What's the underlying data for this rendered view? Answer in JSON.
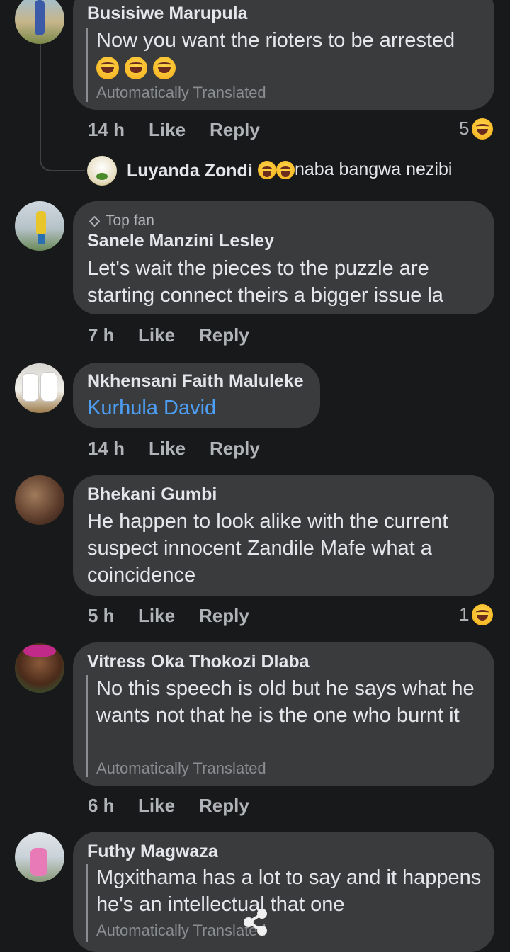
{
  "comments": [
    {
      "name": "Busisiwe Marupula",
      "text": "Now you want the rioters to be arrested",
      "translated": "Automatically Translated",
      "time": "14 h",
      "like": "Like",
      "reply": "Reply",
      "reaction_count": "5"
    },
    {
      "name": "Luyanda Zondi",
      "text": "naba bangwa nezibi"
    },
    {
      "badge": "Top fan",
      "name": "Sanele Manzini Lesley",
      "text": "Let's wait the pieces to the puzzle are starting connect theirs a bigger issue la",
      "time": "7 h",
      "like": "Like",
      "reply": "Reply"
    },
    {
      "name": "Nkhensani Faith Maluleke",
      "text": "Kurhula David",
      "time": "14 h",
      "like": "Like",
      "reply": "Reply"
    },
    {
      "name": "Bhekani Gumbi",
      "text": "He happen to look alike with the current suspect  innocent Zandile Mafe what a coincidence",
      "time": "5 h",
      "like": "Like",
      "reply": "Reply",
      "reaction_count": "1"
    },
    {
      "name": "Vitress Oka Thokozi Dlaba",
      "text": "No this speech is old but he says what he wants not that he is the one who burnt it",
      "translated": "Automatically Translated",
      "time": "6 h",
      "like": "Like",
      "reply": "Reply"
    },
    {
      "name": "Futhy Magwaza",
      "text": "Mgxithama has a lot to say and it happens he's an intellectual that one",
      "translated": "Automatically Translated"
    }
  ],
  "colors": {
    "background": "#18191a",
    "bubble": "#3a3b3c",
    "link": "#4d9ef5",
    "secondary_text": "#b0b3b8"
  },
  "icons": [
    "laughing-emoji-icon",
    "top-fan-badge-icon",
    "share-icon"
  ]
}
